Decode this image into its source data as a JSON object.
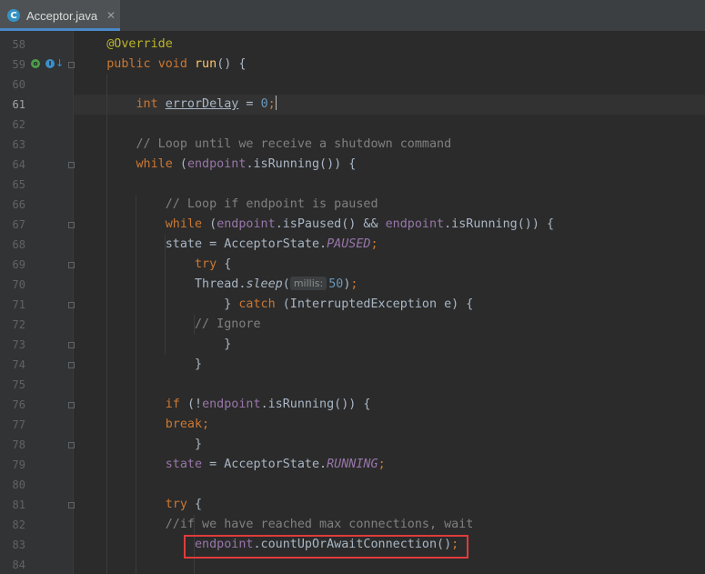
{
  "tab": {
    "icon": "C",
    "label": "Acceptor.java",
    "close": "✕"
  },
  "gutter_markers": {
    "override": "o",
    "implements": "I",
    "arrow": "↓"
  },
  "param_hint": "millis:",
  "lines": [
    {
      "num": "58",
      "tokens": [
        [
          "ann",
          "@Override"
        ]
      ]
    },
    {
      "num": "59",
      "tokens": [
        [
          "kw",
          "public "
        ],
        [
          "kw",
          "void "
        ],
        [
          "fn",
          "run"
        ],
        [
          "p",
          "() {"
        ]
      ]
    },
    {
      "num": "60",
      "tokens": []
    },
    {
      "num": "61",
      "tokens": [
        [
          "kw",
          "int "
        ],
        [
          "var",
          "errorDelay"
        ],
        [
          "p",
          " = "
        ],
        [
          "num",
          "0"
        ],
        [
          "kw",
          ";"
        ]
      ]
    },
    {
      "num": "62",
      "tokens": []
    },
    {
      "num": "63",
      "tokens": [
        [
          "cm",
          "// Loop until we receive a shutdown command"
        ]
      ]
    },
    {
      "num": "64",
      "tokens": [
        [
          "kw",
          "while "
        ],
        [
          "p",
          "("
        ],
        [
          "fld",
          "endpoint"
        ],
        [
          "p",
          ".isRunning()) {"
        ]
      ]
    },
    {
      "num": "65",
      "tokens": []
    },
    {
      "num": "66",
      "tokens": [
        [
          "cm",
          "// Loop if endpoint is paused"
        ]
      ]
    },
    {
      "num": "67",
      "tokens": [
        [
          "kw",
          "while "
        ],
        [
          "p",
          "("
        ],
        [
          "fld",
          "endpoint"
        ],
        [
          "p",
          ".isPaused() && "
        ],
        [
          "fld",
          "endpoint"
        ],
        [
          "p",
          ".isRunning()) {"
        ]
      ]
    },
    {
      "num": "68",
      "tokens": [
        [
          "p",
          "state = AcceptorState."
        ],
        [
          "const",
          "PAUSED"
        ],
        [
          "kw",
          ";"
        ]
      ]
    },
    {
      "num": "69",
      "tokens": [
        [
          "kw",
          "try "
        ],
        [
          "p",
          "{"
        ]
      ]
    },
    {
      "num": "70",
      "tokens": [
        [
          "p",
          "Thread."
        ],
        [
          "static",
          "sleep"
        ],
        [
          "p",
          "("
        ],
        [
          "hint",
          "millis:"
        ],
        [
          "num",
          "50"
        ],
        [
          "p",
          ")"
        ],
        [
          "kw",
          ";"
        ]
      ]
    },
    {
      "num": "71",
      "tokens": [
        [
          "p",
          "} "
        ],
        [
          "kw",
          "catch "
        ],
        [
          "p",
          "(InterruptedException e) {"
        ]
      ]
    },
    {
      "num": "72",
      "tokens": [
        [
          "cm",
          "// Ignore"
        ]
      ]
    },
    {
      "num": "73",
      "tokens": [
        [
          "p",
          "}"
        ]
      ]
    },
    {
      "num": "74",
      "tokens": [
        [
          "p",
          "}"
        ]
      ]
    },
    {
      "num": "75",
      "tokens": []
    },
    {
      "num": "76",
      "tokens": [
        [
          "kw",
          "if "
        ],
        [
          "p",
          "(!"
        ],
        [
          "fld",
          "endpoint"
        ],
        [
          "p",
          ".isRunning()) {"
        ]
      ]
    },
    {
      "num": "77",
      "tokens": [
        [
          "kw",
          "break;"
        ]
      ]
    },
    {
      "num": "78",
      "tokens": [
        [
          "p",
          "}"
        ]
      ]
    },
    {
      "num": "79",
      "tokens": [
        [
          "fld",
          "state"
        ],
        [
          "p",
          " = AcceptorState."
        ],
        [
          "const",
          "RUNNING"
        ],
        [
          "kw",
          ";"
        ]
      ]
    },
    {
      "num": "80",
      "tokens": []
    },
    {
      "num": "81",
      "tokens": [
        [
          "kw",
          "try "
        ],
        [
          "p",
          "{"
        ]
      ]
    },
    {
      "num": "82",
      "tokens": [
        [
          "cm",
          "//if we have reached max connections, wait"
        ]
      ]
    },
    {
      "num": "83",
      "tokens": [
        [
          "fld",
          "endpoint"
        ],
        [
          "p",
          ".countUpOrAwaitConnection()"
        ],
        [
          "kw",
          ";"
        ]
      ]
    },
    {
      "num": "84",
      "tokens": []
    }
  ]
}
